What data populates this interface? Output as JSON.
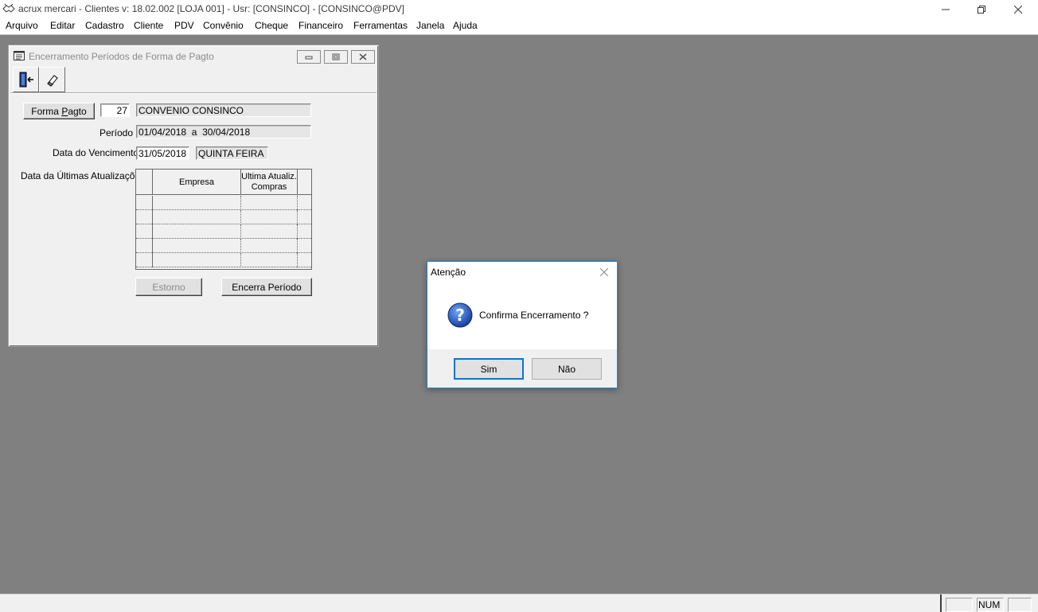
{
  "window": {
    "title": "acrux mercari - Clientes  v: 18.02.002  [LOJA 001] - Usr: [CONSINCO] - [CONSINCO@PDV]",
    "app_icon": "handshake-icon"
  },
  "menu": {
    "items": [
      "Arquivo",
      "Editar",
      "Cadastro",
      "Cliente",
      "PDV",
      "Convênio",
      "Cheque",
      "Financeiro",
      "Ferramentas",
      "Janela",
      "Ajuda"
    ]
  },
  "child": {
    "title": "Encerramento Períodos de Forma de Pagto",
    "toolbar": {
      "exit_icon": "exit-door-icon",
      "clear_icon": "eraser-icon"
    },
    "forma_pagto_button_pre": "Forma ",
    "forma_pagto_button_u": "P",
    "forma_pagto_button_post": "agto",
    "forma_pagto_code": "27",
    "forma_pagto_name": "CONVENIO CONSINCO",
    "periodo_label": "Período",
    "periodo_value": "01/04/2018  a  30/04/2018",
    "vencimento_label": "Data do Vencimento",
    "vencimento_date": "31/05/2018",
    "vencimento_weekday": "QUINTA FEIRA",
    "atualizacoes_label": "Data da Últimas Atualizações",
    "grid": {
      "col_empresa": "Empresa",
      "col_ultima_1": "Ultima Atualiz.",
      "col_ultima_2": "Compras",
      "rows": 5
    },
    "estorno_button": "Estorno",
    "encerra_button": "Encerra Período"
  },
  "dialog": {
    "title": "Atenção",
    "icon": "question-icon",
    "message": "Confirma Encerramento ?",
    "yes_button": "Sim",
    "no_button": "Não"
  },
  "statusbar": {
    "num_indicator": "NUM"
  }
}
